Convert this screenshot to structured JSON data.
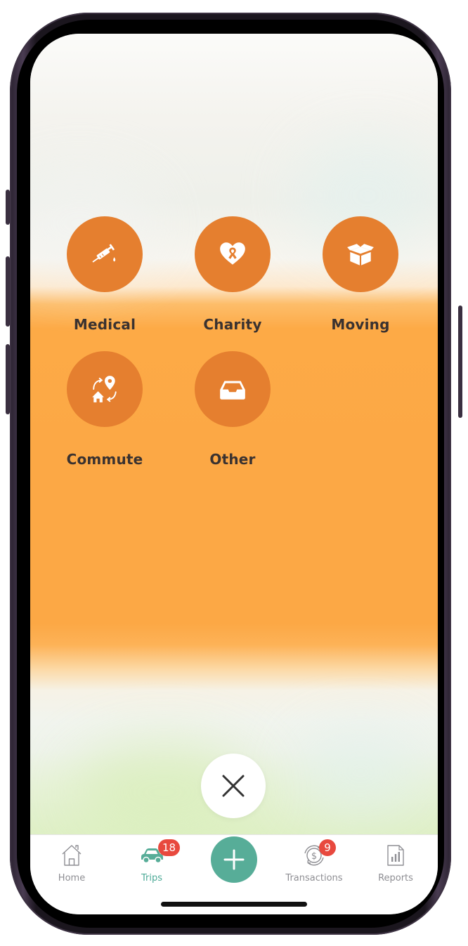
{
  "categories": [
    {
      "id": "medical",
      "label": "Medical",
      "icon": "syringe-icon"
    },
    {
      "id": "charity",
      "label": "Charity",
      "icon": "heart-ribbon-icon"
    },
    {
      "id": "moving",
      "label": "Moving",
      "icon": "open-box-icon"
    },
    {
      "id": "commute",
      "label": "Commute",
      "icon": "home-to-location-icon"
    },
    {
      "id": "other",
      "label": "Other",
      "icon": "inbox-tray-icon"
    }
  ],
  "close_button": {
    "icon": "close-icon"
  },
  "tabbar": {
    "tabs": [
      {
        "id": "home",
        "label": "Home",
        "icon": "house-icon",
        "active": false
      },
      {
        "id": "trips",
        "label": "Trips",
        "icon": "car-icon",
        "active": true,
        "badge": "18"
      },
      {
        "id": "add",
        "label": "",
        "icon": "plus-icon"
      },
      {
        "id": "transactions",
        "label": "Transactions",
        "icon": "dollar-cycle-icon",
        "active": false,
        "badge": "9"
      },
      {
        "id": "reports",
        "label": "Reports",
        "icon": "report-chart-icon",
        "active": false
      }
    ]
  },
  "colors": {
    "category_circle": "#e57f2f",
    "accent_green": "#57ad98",
    "badge_red": "#e8493e",
    "overlay_orange": "#fca845"
  }
}
